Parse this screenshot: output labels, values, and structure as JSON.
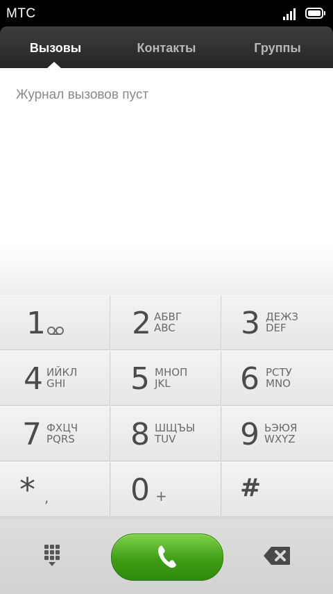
{
  "status_bar": {
    "carrier": "МТС",
    "signal_icon": "signal-bars-icon",
    "battery_icon": "battery-full-icon"
  },
  "tabs": [
    {
      "label": "Вызовы",
      "active": true
    },
    {
      "label": "Контакты",
      "active": false
    },
    {
      "label": "Группы",
      "active": false
    }
  ],
  "call_log": {
    "empty_message": "Журнал вызовов пуст"
  },
  "keypad": {
    "keys": [
      {
        "digit": "1",
        "letters_ru": "",
        "letters_en": "",
        "icon": "voicemail-icon"
      },
      {
        "digit": "2",
        "letters_ru": "АБВГ",
        "letters_en": "ABC"
      },
      {
        "digit": "3",
        "letters_ru": "ДЕЖЗ",
        "letters_en": "DEF"
      },
      {
        "digit": "4",
        "letters_ru": "ИЙКЛ",
        "letters_en": "GHI"
      },
      {
        "digit": "5",
        "letters_ru": "МНОП",
        "letters_en": "JKL"
      },
      {
        "digit": "6",
        "letters_ru": "РСТУ",
        "letters_en": "MNO"
      },
      {
        "digit": "7",
        "letters_ru": "ФХЦЧ",
        "letters_en": "PQRS"
      },
      {
        "digit": "8",
        "letters_ru": "ШЩЪЫ",
        "letters_en": "TUV"
      },
      {
        "digit": "9",
        "letters_ru": "ЬЭЮЯ",
        "letters_en": "WXYZ"
      },
      {
        "digit": "*",
        "sub": ","
      },
      {
        "digit": "0",
        "sub": "+"
      },
      {
        "digit": "#",
        "sub": ""
      }
    ]
  },
  "bottom_bar": {
    "dialpad_icon": "dialpad-grid-icon",
    "call_icon": "phone-handset-icon",
    "backspace_icon": "backspace-icon",
    "call_color": "#3f9e17"
  }
}
